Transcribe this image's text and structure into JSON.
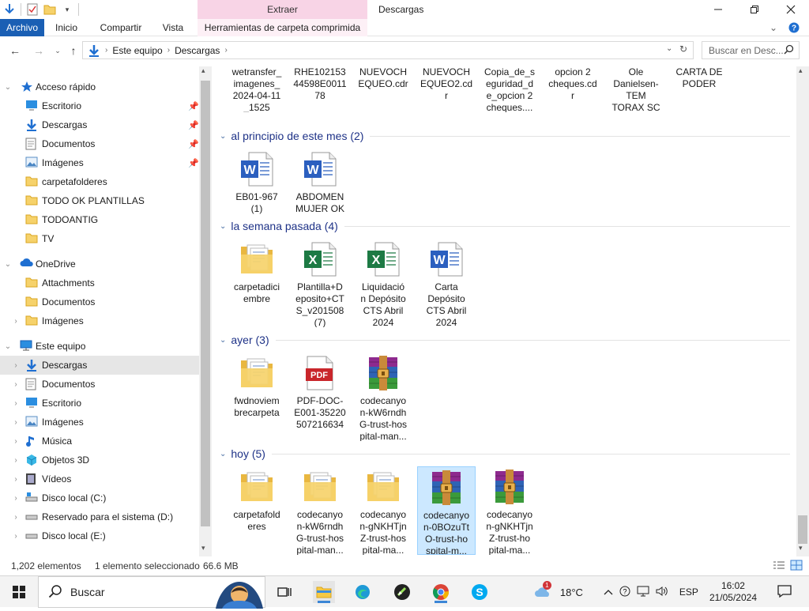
{
  "title_bar": {
    "context_tab_label": "Extraer",
    "window_title": "Descargas"
  },
  "ribbon": {
    "tabs": [
      "Archivo",
      "Inicio",
      "Compartir",
      "Vista",
      "Herramientas de carpeta comprimida"
    ]
  },
  "address": {
    "crumbs": [
      "Este equipo",
      "Descargas"
    ],
    "search_placeholder": "Buscar en Desc..."
  },
  "nav_pane": {
    "quick_access": "Acceso rápido",
    "quick_items": [
      "Escritorio",
      "Descargas",
      "Documentos",
      "Imágenes",
      "carpetafolderes",
      "TODO OK PLANTILLAS",
      "TODOANTIG",
      "TV"
    ],
    "onedrive": "OneDrive",
    "onedrive_items": [
      "Attachments",
      "Documentos",
      "Imágenes"
    ],
    "this_pc": "Este equipo",
    "pc_items": [
      "Descargas",
      "Documentos",
      "Escritorio",
      "Imágenes",
      "Música",
      "Objetos 3D",
      "Vídeos",
      "Disco local (C:)",
      "Reservado para el sistema (D:)",
      "Disco local (E:)"
    ]
  },
  "content": {
    "top_row": [
      {
        "name": "wetransfer_imagenes_2024-04-11_1525",
        "lines": [
          "wetransfer_",
          "imagenes_",
          "2024-04-11",
          "_1525"
        ],
        "icon": "zip-icon"
      },
      {
        "name": "RHE10215344598E001178",
        "lines": [
          "RHE102153",
          "44598E0011",
          "78"
        ],
        "icon": "pdf-icon"
      },
      {
        "name": "NUEVOCHEQUEO.cdr",
        "lines": [
          "NUEVOCH",
          "EQUEO.cdr"
        ],
        "icon": "file-icon"
      },
      {
        "name": "NUEVOCHEQUEO2.cdr",
        "lines": [
          "NUEVOCH",
          "EQUEO2.cd",
          "r"
        ],
        "icon": "file-icon"
      },
      {
        "name": "Copia_de_seguridad_de_opcion 2 cheques",
        "lines": [
          "Copia_de_s",
          "eguridad_d",
          "e_opcion 2",
          "cheques...."
        ],
        "icon": "file-icon"
      },
      {
        "name": "opcion 2 cheques.cdr",
        "lines": [
          "opcion 2",
          "cheques.cd",
          "r"
        ],
        "icon": "file-icon"
      },
      {
        "name": "Ole Danielsen-TEM TORAX SC",
        "lines": [
          "Ole",
          "Danielsen-",
          "TEM",
          "TORAX SC"
        ],
        "icon": "pdf-icon"
      },
      {
        "name": "CARTA DE PODER",
        "lines": [
          "CARTA DE",
          "PODER"
        ],
        "icon": "file-icon"
      }
    ],
    "groups": [
      {
        "header": "al principio de este mes (2)",
        "items": [
          {
            "lines": [
              "EB01-967",
              "(1)"
            ],
            "icon": "word-icon"
          },
          {
            "lines": [
              "ABDOMEN",
              "MUJER OK"
            ],
            "icon": "word-icon"
          }
        ]
      },
      {
        "header": "la semana pasada (4)",
        "items": [
          {
            "lines": [
              "carpetadici",
              "embre"
            ],
            "icon": "folder-icon"
          },
          {
            "lines": [
              "Plantilla+D",
              "eposito+CT",
              "S_v201508",
              "(7)"
            ],
            "icon": "excel-icon"
          },
          {
            "lines": [
              "Liquidació",
              "n Depósito",
              "CTS Abril",
              "2024"
            ],
            "icon": "excel-icon"
          },
          {
            "lines": [
              "Carta",
              "Depósito",
              "CTS Abril",
              "2024"
            ],
            "icon": "word-icon"
          }
        ]
      },
      {
        "header": "ayer (3)",
        "items": [
          {
            "lines": [
              "fwdnoviem",
              "brecarpeta"
            ],
            "icon": "folder-icon"
          },
          {
            "lines": [
              "PDF-DOC-",
              "E001-35220",
              "507216634"
            ],
            "icon": "pdf-icon"
          },
          {
            "lines": [
              "codecanyo",
              "n-kW6rndh",
              "G-trust-hos",
              "pital-man..."
            ],
            "icon": "rar-icon"
          }
        ]
      },
      {
        "header": "hoy (5)",
        "items": [
          {
            "lines": [
              "carpetafold",
              "eres"
            ],
            "icon": "folder-icon"
          },
          {
            "lines": [
              "codecanyo",
              "n-kW6rndh",
              "G-trust-hos",
              "pital-man..."
            ],
            "icon": "folder-icon"
          },
          {
            "lines": [
              "codecanyo",
              "n-gNKHTjn",
              "Z-trust-hos",
              "pital-ma..."
            ],
            "icon": "folder-icon"
          },
          {
            "lines": [
              "codecanyo",
              "n-0BOzuTt",
              "O-trust-ho",
              "spital-m..."
            ],
            "icon": "rar-icon",
            "selected": true
          },
          {
            "lines": [
              "codecanyo",
              "n-gNKHTjn",
              "Z-trust-ho",
              "pital-ma..."
            ],
            "icon": "rar-icon"
          }
        ]
      }
    ]
  },
  "status_bar": {
    "count": "1,202 elementos",
    "selection": "1 elemento seleccionado",
    "size": "66.6 MB"
  },
  "taskbar": {
    "search_label": "Buscar",
    "weather_badge": "1",
    "temperature": "18°C",
    "language": "ESP",
    "time": "16:02",
    "date": "21/05/2024"
  },
  "colors": {
    "accent": "#1a5fb4",
    "context_tab": "#f8d4e6",
    "group_header": "#1e3287",
    "selection": "#cce8ff"
  }
}
